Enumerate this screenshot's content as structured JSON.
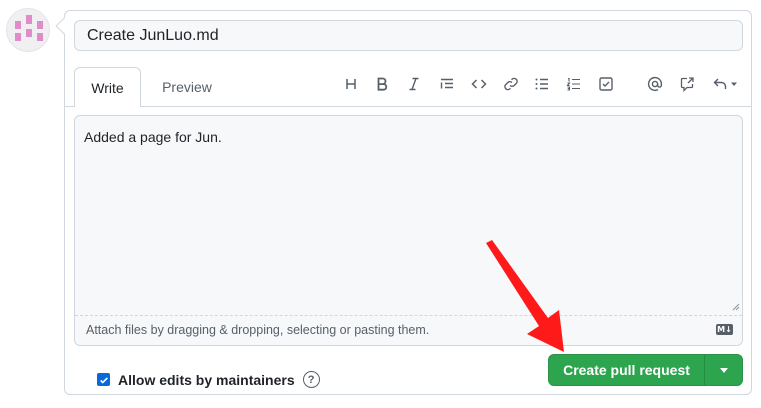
{
  "pull_request": {
    "title_value": "Create JunLuo.md",
    "tabs": {
      "write": "Write",
      "preview": "Preview"
    },
    "toolbar": [
      {
        "name": "heading-icon",
        "glyph": "H"
      },
      {
        "name": "bold-icon",
        "glyph": "B"
      },
      {
        "name": "italic-icon",
        "glyph": "I"
      },
      {
        "name": "quote-icon"
      },
      {
        "name": "code-icon"
      },
      {
        "name": "link-icon"
      },
      {
        "name": "bulleted-list-icon"
      },
      {
        "name": "numbered-list-icon"
      },
      {
        "name": "task-list-icon"
      },
      {
        "name": "mention-icon"
      },
      {
        "name": "cross-reference-icon"
      },
      {
        "name": "reply-icon"
      }
    ],
    "body_text": "Added a page for Jun.",
    "attach_hint": "Attach files by dragging & dropping, selecting or pasting them.",
    "markdown_badge": "M↓",
    "allow_edits": {
      "label": "Allow edits by maintainers",
      "checked": true
    },
    "help_glyph": "?",
    "create_button_label": "Create pull request"
  },
  "colors": {
    "primary_button": "#2da44e",
    "checkbox": "#0969da",
    "annotation_arrow": "#ff1a1a",
    "avatar_accent": "#e08cc8"
  }
}
